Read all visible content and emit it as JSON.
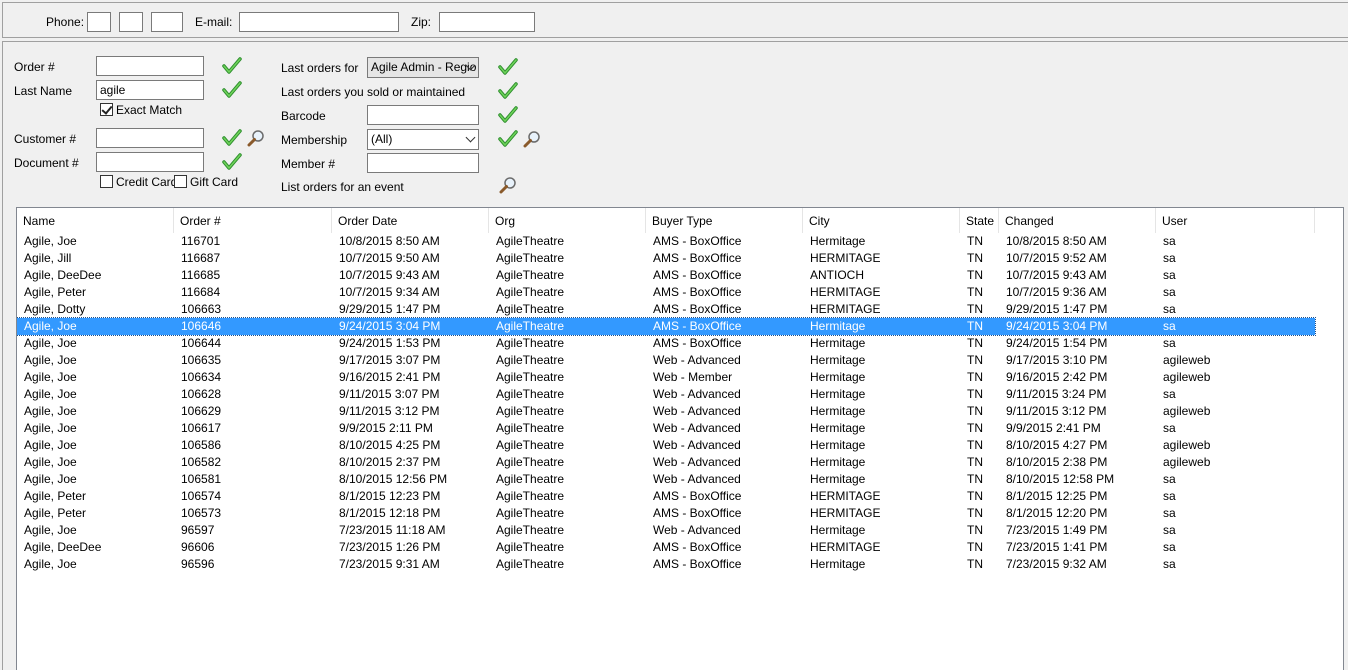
{
  "contact": {
    "phone_label": "Phone:",
    "email_label": "E-mail:",
    "zip_label": "Zip:"
  },
  "search": {
    "order_label": "Order #",
    "last_name_label": "Last Name",
    "last_name_value": "agile",
    "exact_match_label": "Exact Match",
    "customer_label": "Customer #",
    "document_label": "Document #",
    "credit_card_label": "Credit Card",
    "gift_card_label": "Gift Card",
    "last_orders_for_label": "Last orders for",
    "last_orders_for_value": "Agile Admin - Regio",
    "last_orders_sold_label": "Last orders you sold or maintained",
    "barcode_label": "Barcode",
    "membership_label": "Membership",
    "membership_value": "(All)",
    "member_label": "Member #",
    "event_label": "List orders for an event"
  },
  "grid": {
    "columns": [
      "Name",
      "Order #",
      "Order Date",
      "Org",
      "Buyer Type",
      "City",
      "State",
      "Changed",
      "User"
    ],
    "selected_index": 5,
    "rows": [
      [
        "Agile, Joe",
        "116701",
        "10/8/2015 8:50 AM",
        "AgileTheatre",
        "AMS - BoxOffice",
        "Hermitage",
        "TN",
        "10/8/2015 8:50 AM",
        "sa"
      ],
      [
        "Agile, Jill",
        "116687",
        "10/7/2015 9:50 AM",
        "AgileTheatre",
        "AMS - BoxOffice",
        "HERMITAGE",
        "TN",
        "10/7/2015 9:52 AM",
        "sa"
      ],
      [
        "Agile, DeeDee",
        "116685",
        "10/7/2015 9:43 AM",
        "AgileTheatre",
        "AMS - BoxOffice",
        "ANTIOCH",
        "TN",
        "10/7/2015 9:43 AM",
        "sa"
      ],
      [
        "Agile, Peter",
        "116684",
        "10/7/2015 9:34 AM",
        "AgileTheatre",
        "AMS - BoxOffice",
        "HERMITAGE",
        "TN",
        "10/7/2015 9:36 AM",
        "sa"
      ],
      [
        "Agile, Dotty",
        "106663",
        "9/29/2015 1:47 PM",
        "AgileTheatre",
        "AMS - BoxOffice",
        "HERMITAGE",
        "TN",
        "9/29/2015 1:47 PM",
        "sa"
      ],
      [
        "Agile, Joe",
        "106646",
        "9/24/2015 3:04 PM",
        "AgileTheatre",
        "AMS - BoxOffice",
        "Hermitage",
        "TN",
        "9/24/2015 3:04 PM",
        "sa"
      ],
      [
        "Agile, Joe",
        "106644",
        "9/24/2015 1:53 PM",
        "AgileTheatre",
        "AMS - BoxOffice",
        "Hermitage",
        "TN",
        "9/24/2015 1:54 PM",
        "sa"
      ],
      [
        "Agile, Joe",
        "106635",
        "9/17/2015 3:07 PM",
        "AgileTheatre",
        "Web - Advanced",
        "Hermitage",
        "TN",
        "9/17/2015 3:10 PM",
        "agileweb"
      ],
      [
        "Agile, Joe",
        "106634",
        "9/16/2015 2:41 PM",
        "AgileTheatre",
        "Web - Member",
        "Hermitage",
        "TN",
        "9/16/2015 2:42 PM",
        "agileweb"
      ],
      [
        "Agile, Joe",
        "106628",
        "9/11/2015 3:07 PM",
        "AgileTheatre",
        "Web - Advanced",
        "Hermitage",
        "TN",
        "9/11/2015 3:24 PM",
        "sa"
      ],
      [
        "Agile, Joe",
        "106629",
        "9/11/2015 3:12 PM",
        "AgileTheatre",
        "Web - Advanced",
        "Hermitage",
        "TN",
        "9/11/2015 3:12 PM",
        "agileweb"
      ],
      [
        "Agile, Joe",
        "106617",
        "9/9/2015 2:11 PM",
        "AgileTheatre",
        "Web - Advanced",
        "Hermitage",
        "TN",
        "9/9/2015 2:41 PM",
        "sa"
      ],
      [
        "Agile, Joe",
        "106586",
        "8/10/2015 4:25 PM",
        "AgileTheatre",
        "Web - Advanced",
        "Hermitage",
        "TN",
        "8/10/2015 4:27 PM",
        "agileweb"
      ],
      [
        "Agile, Joe",
        "106582",
        "8/10/2015 2:37 PM",
        "AgileTheatre",
        "Web - Advanced",
        "Hermitage",
        "TN",
        "8/10/2015 2:38 PM",
        "agileweb"
      ],
      [
        "Agile, Joe",
        "106581",
        "8/10/2015 12:56 PM",
        "AgileTheatre",
        "Web - Advanced",
        "Hermitage",
        "TN",
        "8/10/2015 12:58 PM",
        "sa"
      ],
      [
        "Agile, Peter",
        "106574",
        "8/1/2015 12:23 PM",
        "AgileTheatre",
        "AMS - BoxOffice",
        "HERMITAGE",
        "TN",
        "8/1/2015 12:25 PM",
        "sa"
      ],
      [
        "Agile, Peter",
        "106573",
        "8/1/2015 12:18 PM",
        "AgileTheatre",
        "AMS - BoxOffice",
        "HERMITAGE",
        "TN",
        "8/1/2015 12:20 PM",
        "sa"
      ],
      [
        "Agile, Joe",
        "96597",
        "7/23/2015 11:18 AM",
        "AgileTheatre",
        "Web - Advanced",
        "Hermitage",
        "TN",
        "7/23/2015 1:49 PM",
        "sa"
      ],
      [
        "Agile, DeeDee",
        "96606",
        "7/23/2015 1:26 PM",
        "AgileTheatre",
        "AMS - BoxOffice",
        "HERMITAGE",
        "TN",
        "7/23/2015 1:41 PM",
        "sa"
      ],
      [
        "Agile, Joe",
        "96596",
        "7/23/2015 9:31 AM",
        "AgileTheatre",
        "AMS - BoxOffice",
        "Hermitage",
        "TN",
        "7/23/2015 9:32 AM",
        "sa"
      ]
    ]
  }
}
